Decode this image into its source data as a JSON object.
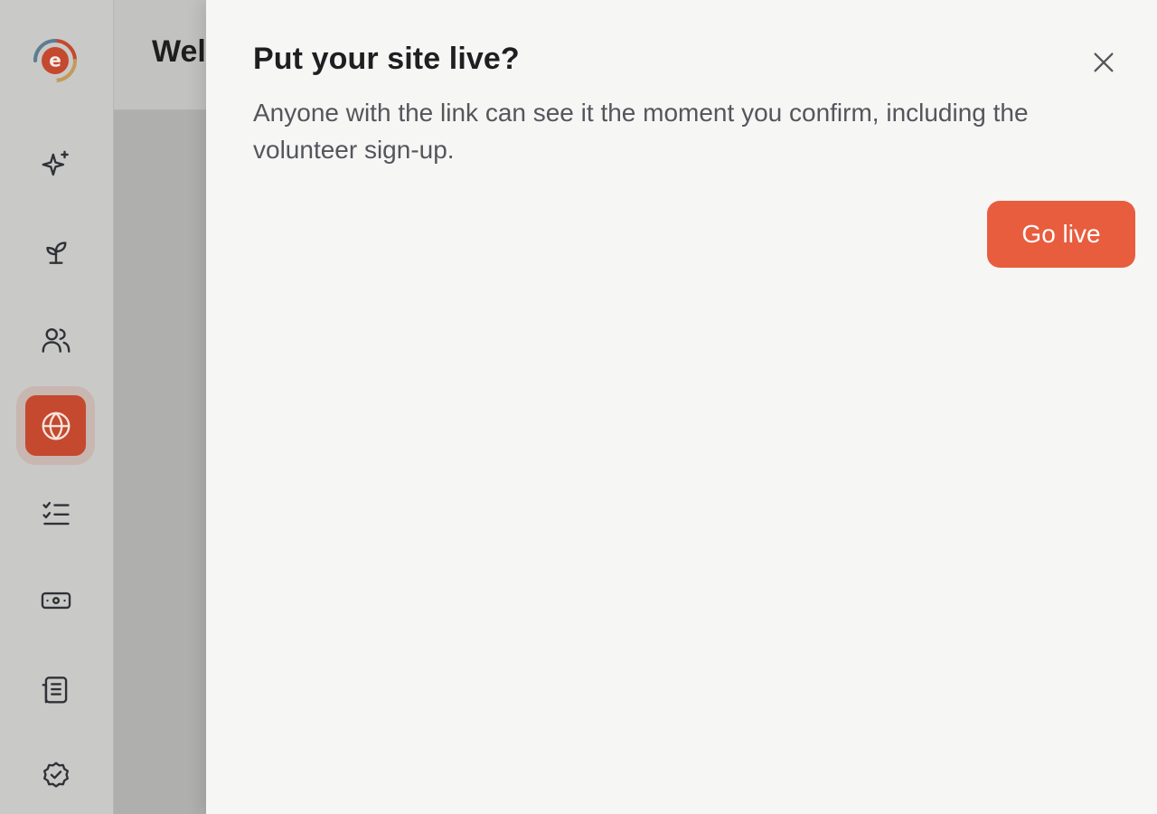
{
  "app": {
    "logo_letter": "e",
    "brand_color": "#e85d3e",
    "accent_active": "#c4492f"
  },
  "sidebar": {
    "items": [
      {
        "icon": "sparkles-icon",
        "active": false
      },
      {
        "icon": "sprout-icon",
        "active": false
      },
      {
        "icon": "users-icon",
        "active": false
      },
      {
        "icon": "globe-icon",
        "active": true
      },
      {
        "icon": "checklist-icon",
        "active": false
      },
      {
        "icon": "banknote-icon",
        "active": false
      },
      {
        "icon": "receipt-icon",
        "active": false
      },
      {
        "icon": "badge-check-icon",
        "active": false
      }
    ]
  },
  "main": {
    "title": "Wel"
  },
  "dialog": {
    "title": "Put your site live?",
    "description": "Anyone with the link can see it the moment you confirm, including the volunteer sign-up.",
    "confirm_label": "Go live",
    "close_icon": "close-icon"
  }
}
